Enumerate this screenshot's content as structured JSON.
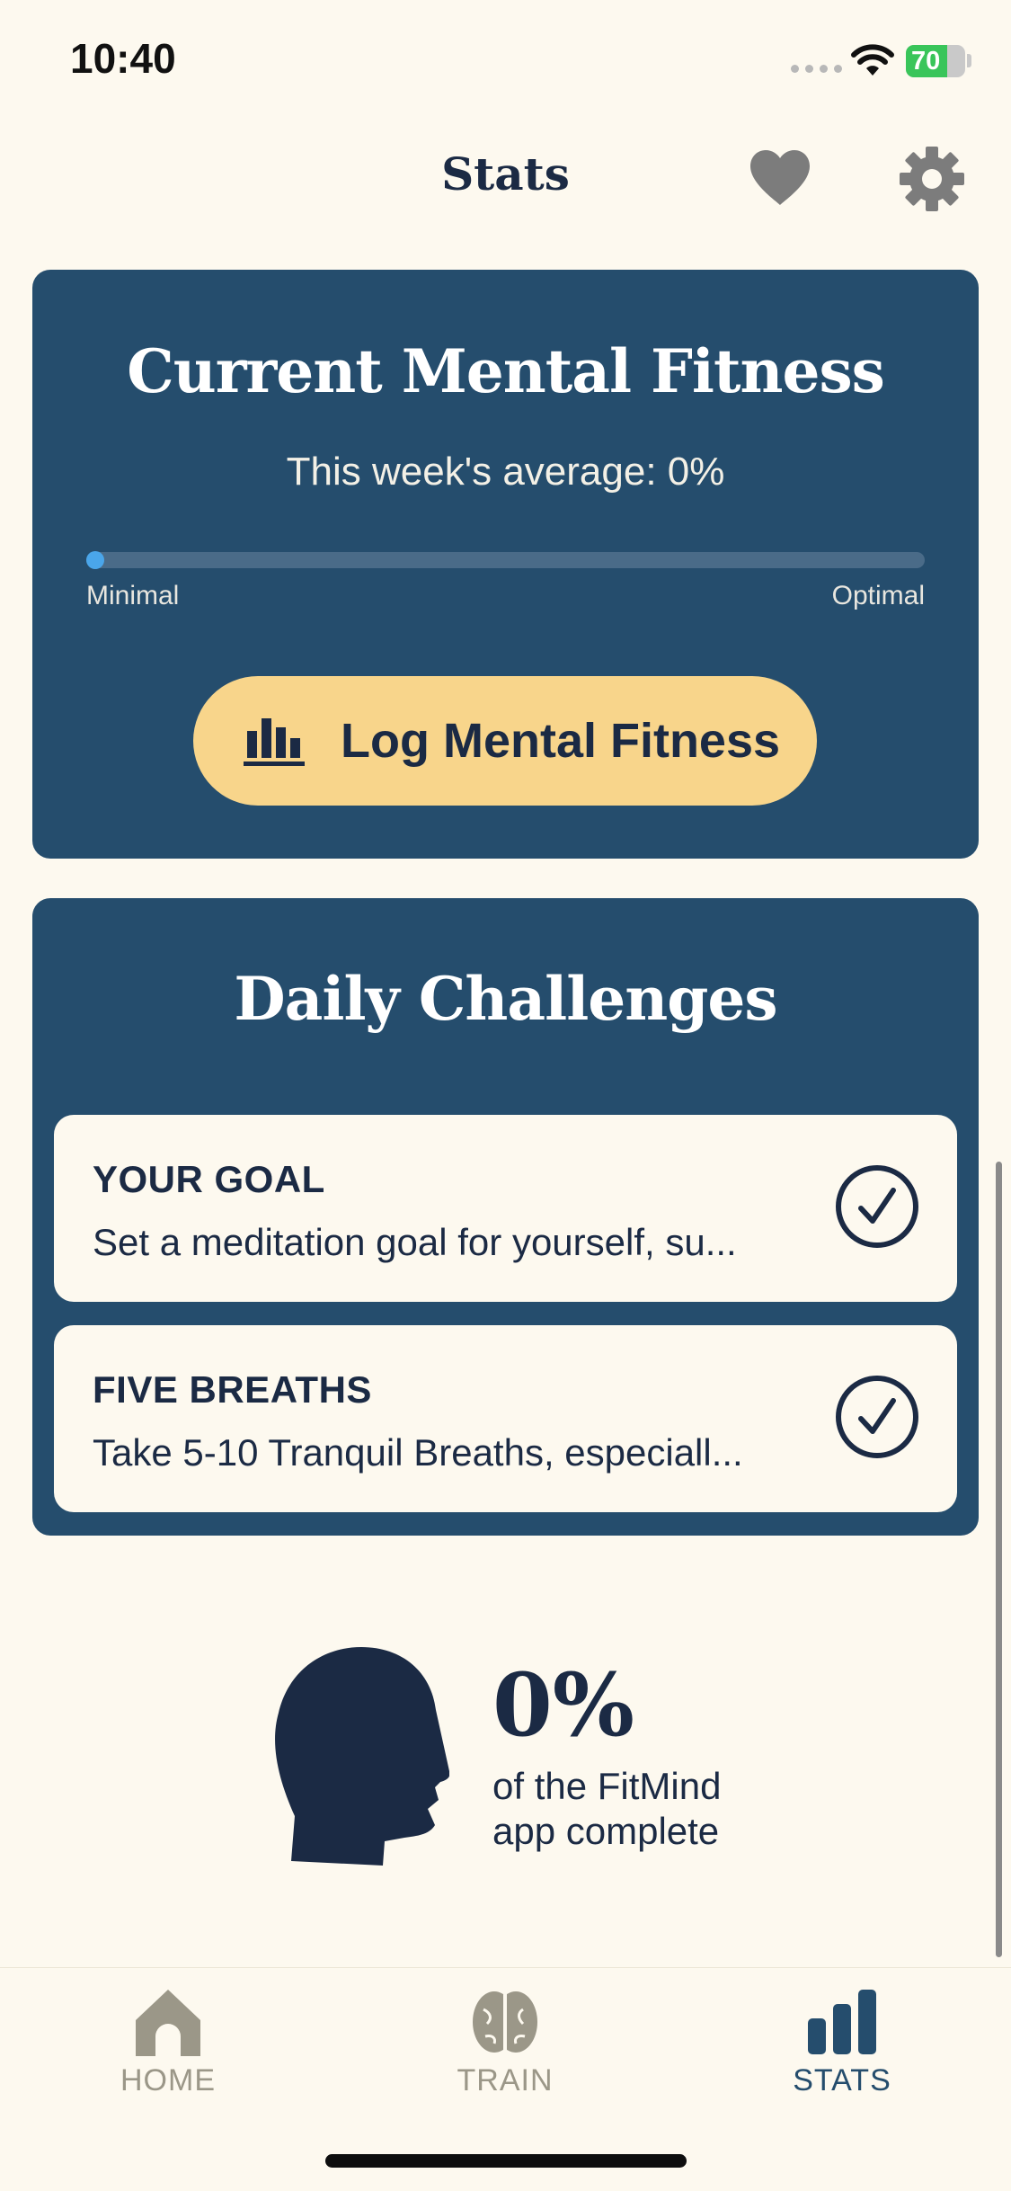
{
  "status_bar": {
    "time": "10:40",
    "battery_level": 70,
    "battery_text": "70"
  },
  "header": {
    "title": "Stats",
    "favorites_icon": "heart-icon",
    "settings_icon": "gear-icon"
  },
  "mental_fitness": {
    "title": "Current Mental Fitness",
    "subtitle": "This week's average: 0%",
    "weekly_average_percent": 0,
    "scale_min_label": "Minimal",
    "scale_max_label": "Optimal",
    "log_button_label": "Log Mental Fitness",
    "log_button_icon": "bar-chart-icon"
  },
  "daily_challenges": {
    "title": "Daily Challenges",
    "items": [
      {
        "name": "YOUR GOAL",
        "description": "Set a meditation goal for yourself, su...",
        "completed": true
      },
      {
        "name": "FIVE BREATHS",
        "description": "Take 5-10 Tranquil Breaths, especiall...",
        "completed": true
      }
    ]
  },
  "app_progress": {
    "percent_text": "0%",
    "caption_line1": "of the FitMind",
    "caption_line2": "app complete",
    "icon": "head-icon"
  },
  "tabbar": {
    "tabs": [
      {
        "label": "HOME",
        "icon": "home-icon",
        "active": false
      },
      {
        "label": "TRAIN",
        "icon": "brain-icon",
        "active": false
      },
      {
        "label": "STATS",
        "icon": "stats-icon",
        "active": true
      }
    ]
  },
  "colors": {
    "background": "#fdf9ef",
    "card": "#254d6d",
    "accent_button": "#f8d58b",
    "text_dark": "#1b2a44",
    "tab_inactive": "#9b9788",
    "progress_dot": "#4aa6ea"
  }
}
